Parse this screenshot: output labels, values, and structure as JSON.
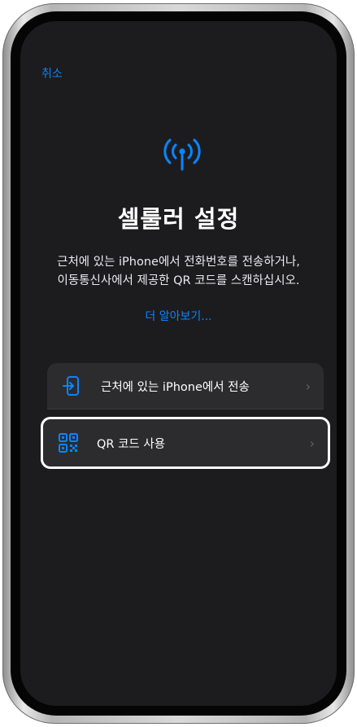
{
  "header": {
    "cancel_label": "취소"
  },
  "main": {
    "title": "셀룰러 설정",
    "description_line1": "근처에 있는 iPhone에서 전화번호를 전송하거나,",
    "description_line2": "이동통신사에서 제공한 QR 코드를 스캔하십시오.",
    "learn_more": "더 알아보기..."
  },
  "options": [
    {
      "label": "근처에 있는 iPhone에서 전송",
      "icon": "phone-transfer-icon"
    },
    {
      "label": "QR 코드 사용",
      "icon": "qr-code-icon"
    }
  ],
  "colors": {
    "accent": "#0a84ff",
    "background": "#1c1c1e",
    "card": "#2c2c2e"
  }
}
